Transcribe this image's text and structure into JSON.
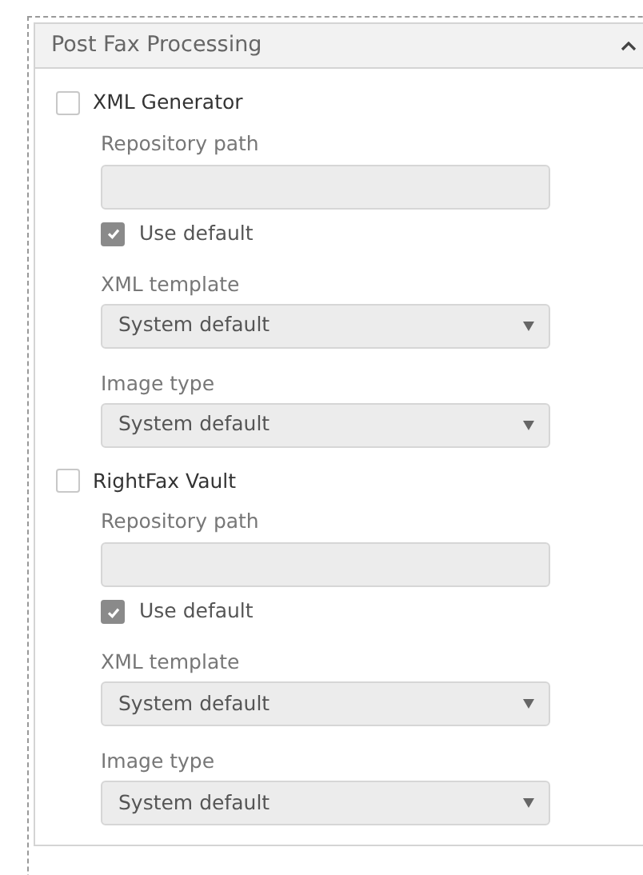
{
  "panel": {
    "title": "Post Fax Processing",
    "expanded": true,
    "sections": [
      {
        "label": "XML Generator",
        "checked": false,
        "fields": [
          {
            "kind": "text",
            "label": "Repository path"
          },
          {
            "kind": "checkbox",
            "label": "Use default",
            "checked": true
          },
          {
            "kind": "select",
            "label": "XML template",
            "value": "System default"
          },
          {
            "kind": "select",
            "label": "Image type",
            "value": "System default"
          }
        ]
      },
      {
        "label": "RightFax Vault",
        "checked": false,
        "fields": [
          {
            "kind": "text",
            "label": "Repository path"
          },
          {
            "kind": "checkbox",
            "label": "Use default",
            "checked": true
          },
          {
            "kind": "select",
            "label": "XML template",
            "value": "System default"
          },
          {
            "kind": "select",
            "label": "Image type",
            "value": "System default"
          }
        ]
      }
    ]
  }
}
